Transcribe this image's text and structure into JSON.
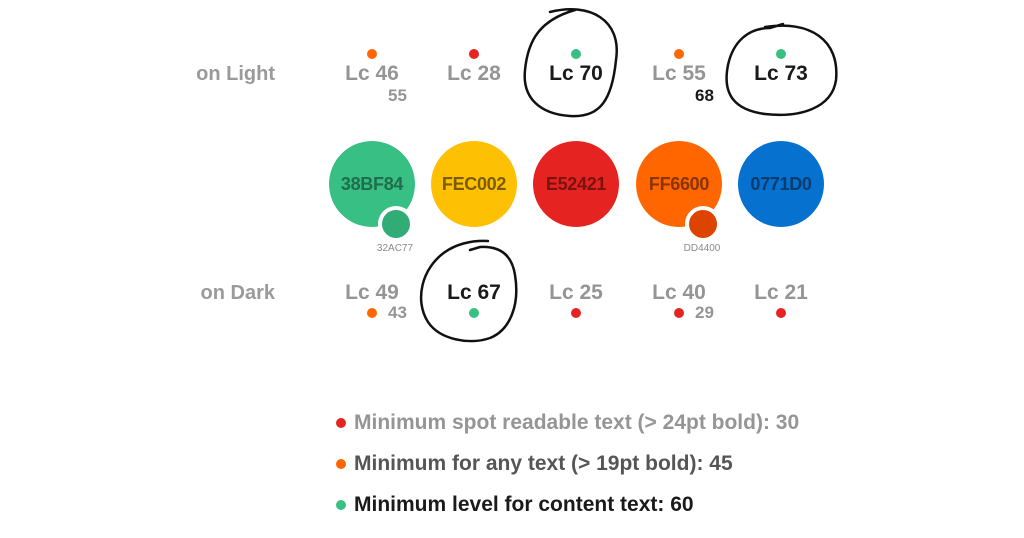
{
  "status_colors": {
    "red": "#E52421",
    "orange": "#FF6600",
    "green": "#38BF84"
  },
  "rows": {
    "light_label": "on Light",
    "dark_label": "on Dark"
  },
  "swatches": [
    {
      "hex": "38BF84",
      "color": "#38BF84",
      "text_color": "#1F6E4C",
      "alt_hex": "32AC77",
      "alt_color": "#32AC77"
    },
    {
      "hex": "FEC002",
      "color": "#FEC002",
      "text_color": "#7A5C00"
    },
    {
      "hex": "E52421",
      "color": "#E52421",
      "text_color": "#7A1210"
    },
    {
      "hex": "FF6600",
      "color": "#FF6600",
      "text_color": "#8A3500",
      "alt_hex": "DD4400",
      "alt_color": "#DD4400"
    },
    {
      "hex": "0771D0",
      "color": "#0771D0",
      "text_color": "#063C6E"
    }
  ],
  "on_light": [
    {
      "label": "Lc 46",
      "status": "orange",
      "alt": "55",
      "pass": false
    },
    {
      "label": "Lc 28",
      "status": "red",
      "pass": false
    },
    {
      "label": "Lc 70",
      "status": "green",
      "pass": true,
      "circled": true
    },
    {
      "label": "Lc 55",
      "status": "orange",
      "alt": "68",
      "alt_pass": true,
      "pass": false
    },
    {
      "label": "Lc 73",
      "status": "green",
      "pass": true,
      "circled": true
    }
  ],
  "on_dark": [
    {
      "label": "Lc 49",
      "status": "orange",
      "alt": "43",
      "pass": false
    },
    {
      "label": "Lc 67",
      "status": "green",
      "pass": true,
      "circled": true
    },
    {
      "label": "Lc 25",
      "status": "red",
      "pass": false
    },
    {
      "label": "Lc 40",
      "status": "red",
      "alt": "29",
      "pass": false
    },
    {
      "label": "Lc 21",
      "status": "red",
      "pass": false
    }
  ],
  "legend": [
    {
      "status": "red",
      "text": "Minimum spot readable text (> 24pt bold): 30",
      "text_color": "#959595"
    },
    {
      "status": "orange",
      "text": "Minimum for any text (> 19pt bold): 45",
      "text_color": "#555555"
    },
    {
      "status": "green",
      "text": "Minimum level for content text: 60",
      "text_color": "#1a1a1a"
    }
  ]
}
